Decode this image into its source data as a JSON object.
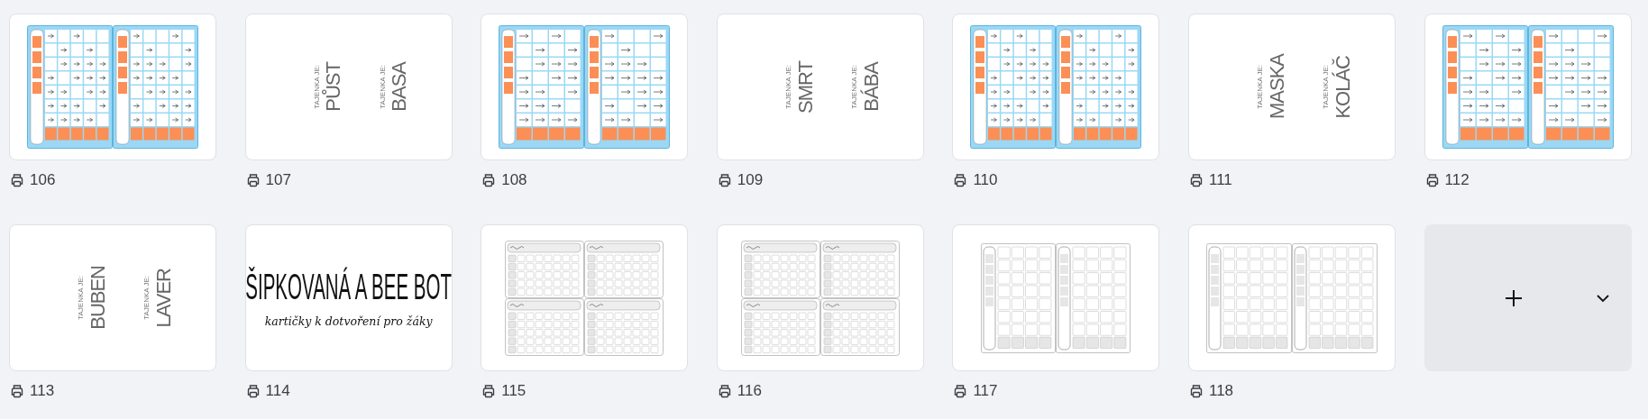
{
  "pages": [
    {
      "number": "106",
      "kind": "arrow-grid"
    },
    {
      "number": "107",
      "kind": "words",
      "words": [
        {
          "caption": "TAJENKA JE:",
          "word": "PŮST"
        },
        {
          "caption": "TAJENKA JE:",
          "word": "BASA"
        }
      ]
    },
    {
      "number": "108",
      "kind": "arrow-grid"
    },
    {
      "number": "109",
      "kind": "words",
      "words": [
        {
          "caption": "TAJENKA JE:",
          "word": "SMRT"
        },
        {
          "caption": "TAJENKA JE:",
          "word": "BÁBA"
        }
      ]
    },
    {
      "number": "110",
      "kind": "arrow-grid"
    },
    {
      "number": "111",
      "kind": "words",
      "words": [
        {
          "caption": "TAJENKA JE:",
          "word": "MASKA"
        },
        {
          "caption": "TAJENKA JE:",
          "word": "KOLÁČ"
        }
      ]
    },
    {
      "number": "112",
      "kind": "arrow-grid"
    },
    {
      "number": "113",
      "kind": "words",
      "words": [
        {
          "caption": "TAJENKA JE:",
          "word": "BUBEN"
        },
        {
          "caption": "TAJENKA JE:",
          "word": "LAVER"
        }
      ]
    },
    {
      "number": "114",
      "kind": "title",
      "title": "ŠIPKOVANÁ A BEE BOT",
      "subtitle": "kartičky k dotvoření pro žáky"
    },
    {
      "number": "115",
      "kind": "card-grid"
    },
    {
      "number": "116",
      "kind": "card-grid"
    },
    {
      "number": "117",
      "kind": "column-grid"
    },
    {
      "number": "118",
      "kind": "column-grid"
    }
  ]
}
